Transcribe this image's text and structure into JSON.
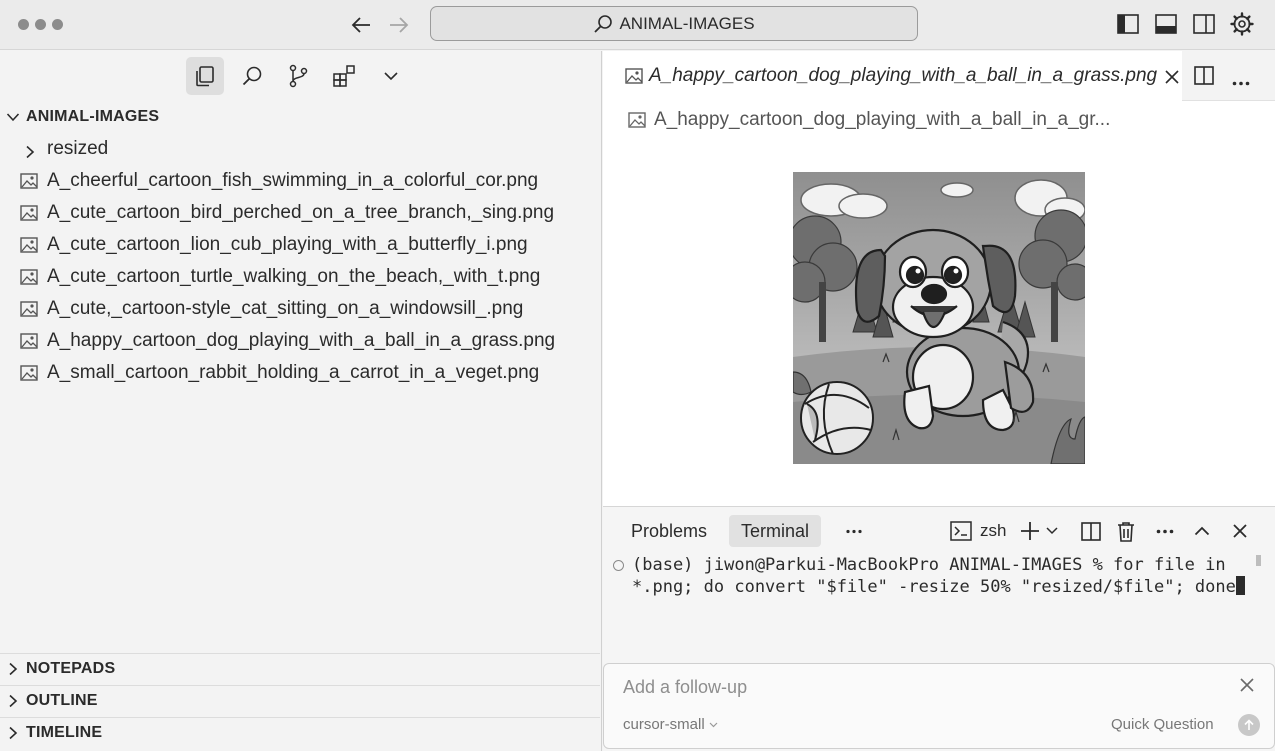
{
  "titlebar": {
    "search_text": "ANIMAL-IMAGES"
  },
  "sidebar": {
    "root_folder": "ANIMAL-IMAGES",
    "folders": [
      {
        "label": "resized"
      }
    ],
    "files": [
      {
        "label": "A_cheerful_cartoon_fish_swimming_in_a_colorful_cor.png"
      },
      {
        "label": "A_cute_cartoon_bird_perched_on_a_tree_branch,_sing.png"
      },
      {
        "label": "A_cute_cartoon_lion_cub_playing_with_a_butterfly_i.png"
      },
      {
        "label": "A_cute_cartoon_turtle_walking_on_the_beach,_with_t.png"
      },
      {
        "label": "A_cute,_cartoon-style_cat_sitting_on_a_windowsill_.png"
      },
      {
        "label": "A_happy_cartoon_dog_playing_with_a_ball_in_a_grass.png"
      },
      {
        "label": "A_small_cartoon_rabbit_holding_a_carrot_in_a_veget.png"
      }
    ],
    "sections": [
      {
        "label": "NOTEPADS"
      },
      {
        "label": "OUTLINE"
      },
      {
        "label": "TIMELINE"
      }
    ]
  },
  "editor": {
    "tab_label": "A_happy_cartoon_dog_playing_with_a_ball_in_a_grass.png",
    "breadcrumb": "A_happy_cartoon_dog_playing_with_a_ball_in_a_gr..."
  },
  "panel": {
    "tabs": [
      {
        "label": "Problems"
      },
      {
        "label": "Terminal"
      }
    ],
    "shell_label": "zsh",
    "terminal_text": "(base) jiwon@Parkui-MacBookPro ANIMAL-IMAGES % for file in *.png; do convert \"$file\" -resize 50% \"resized/$file\"; done"
  },
  "followup": {
    "placeholder": "Add a follow-up",
    "model": "cursor-small",
    "quick_question_label": "Quick Question"
  },
  "colors": {
    "titlebar_bg": "#ebebeb",
    "sidebar_bg": "#f3f3f3",
    "editor_bg": "#ffffff",
    "active_tab_bg": "#e1e1e1"
  }
}
